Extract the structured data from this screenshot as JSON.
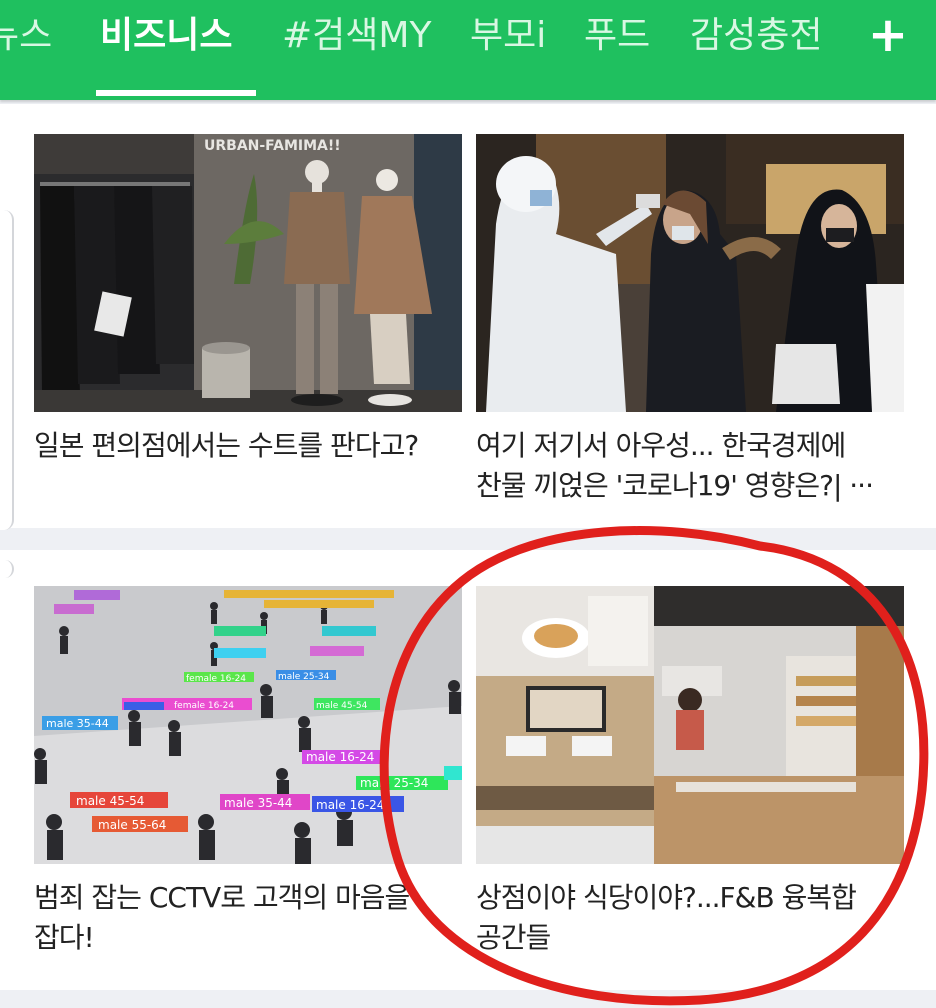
{
  "tabs": [
    {
      "label": "뉴스",
      "visible_text": "뉴스",
      "active": false
    },
    {
      "label": "비즈니스",
      "active": true
    },
    {
      "label": "#검색MY",
      "active": false
    },
    {
      "label": "부모i",
      "active": false
    },
    {
      "label": "푸드",
      "active": false
    },
    {
      "label": "감성충전",
      "active": false
    }
  ],
  "add_tab_label": "+",
  "colors": {
    "brand_green": "#1fc05f",
    "annotation_red": "#e0201c"
  },
  "cards": [
    {
      "caption": "일본 편의점에서는 수트를 판다고?",
      "image_sign_text": "URBAN-FAMIMA!!"
    },
    {
      "caption_line1": "여기 저기서 아우성... 한국경제에",
      "caption_line2": "찬물 끼얹은 '코로나19' 영향은?| ···"
    },
    {
      "caption_line1": "범죄 잡는 CCTV로 고객의 마음을",
      "caption_line2": "잡다!",
      "tags": [
        "male 45-54",
        "male 55-64",
        "male 35-44",
        "male 16-24",
        "male 25-34",
        "female 16-24",
        "male 35-44",
        "male 16-24",
        "male 45-54",
        "female 16-24",
        "male 25-34"
      ]
    },
    {
      "caption_line1": "상점이야 식당이야?...F&B 융복합",
      "caption_line2": "공간들"
    }
  ]
}
